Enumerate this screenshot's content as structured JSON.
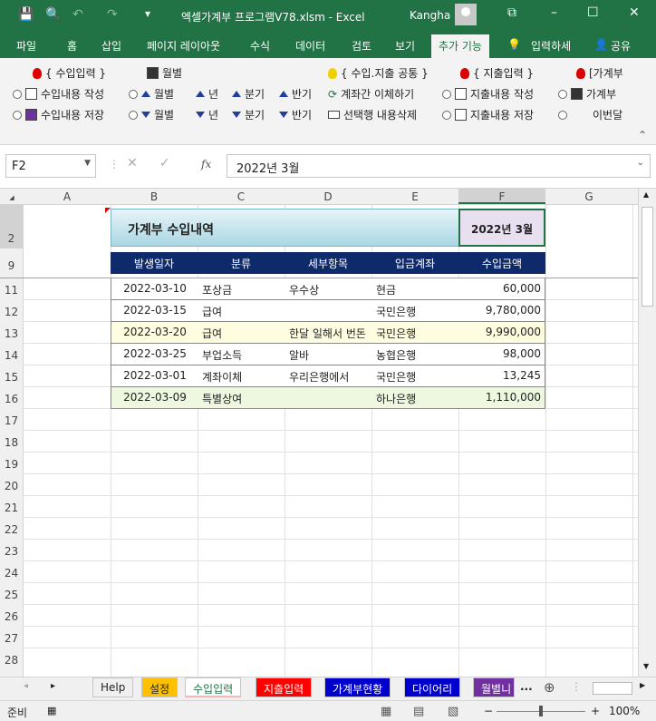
{
  "titlebar": {
    "title": "엑셀가계부 프로그램V78.xlsm  -  Excel",
    "user": "Kangha",
    "minimize_glyph": "–",
    "restore_glyph": "☐",
    "close_glyph": "✕",
    "ribbon_display_glyph": "⧉",
    "save_glyph": "💾",
    "preview_glyph": "🔍",
    "undo_glyph": "↶",
    "redo_glyph": "↷",
    "customize_glyph": "▾"
  },
  "menu": {
    "items": [
      "파일",
      "홈",
      "삽입",
      "페이지 레이아웃",
      "수식",
      "데이터",
      "검토",
      "보기",
      "추가 기능"
    ],
    "tell_me": "입력하세",
    "share": "공유"
  },
  "ribbon": {
    "income_header": "{ 수입입력 }",
    "monthly_header": "월별",
    "common_header": "{ 수입.지출 공통 }",
    "expense_header": "{ 지출입력 }",
    "ledger_header": "[가계부",
    "write_income": "수입내용 작성",
    "save_income": "수입내용 저장",
    "month_up": "월별",
    "month_down": "월별",
    "year_up": "년",
    "year_down": "년",
    "quarter_up": "분기",
    "quarter_down": "분기",
    "half_up": "반기",
    "half_down": "반기",
    "transfer": "계좌간 이체하기",
    "delete_row": "선택행 내용삭제",
    "write_expense": "지출내용 작성",
    "save_expense": "지출내용 저장",
    "ledger_item": "가계부",
    "this_month": "이번달",
    "collapse_glyph": "⌃"
  },
  "formula": {
    "name_box": "F2",
    "content": "2022년 3월",
    "cancel_glyph": "✕",
    "enter_glyph": "✓",
    "fx": "fx"
  },
  "columns": [
    "A",
    "B",
    "C",
    "D",
    "E",
    "F",
    "G"
  ],
  "rows": [
    "2",
    "9",
    "11",
    "12",
    "13",
    "14",
    "15",
    "16",
    "17",
    "18",
    "19",
    "20",
    "21",
    "22",
    "23",
    "24",
    "25",
    "26",
    "27",
    "28"
  ],
  "sheet": {
    "title": "가계부 수입내역",
    "month": "2022년 3월",
    "headers": [
      "발생일자",
      "분류",
      "세부항목",
      "입금계좌",
      "수입금액"
    ],
    "data": [
      {
        "date": "2022-03-10",
        "cat": "포상금",
        "detail": "우수상",
        "account": "현금",
        "amount": "60,000"
      },
      {
        "date": "2022-03-15",
        "cat": "급여",
        "detail": "",
        "account": "국민은행",
        "amount": "9,780,000"
      },
      {
        "date": "2022-03-20",
        "cat": "급여",
        "detail": "한달 일해서 번돈",
        "account": "국민은행",
        "amount": "9,990,000"
      },
      {
        "date": "2022-03-25",
        "cat": "부업소득",
        "detail": "알바",
        "account": "농협은행",
        "amount": "98,000"
      },
      {
        "date": "2022-03-01",
        "cat": "계좌이체",
        "detail": "우리은행에서",
        "account": "국민은행",
        "amount": "13,245"
      },
      {
        "date": "2022-03-09",
        "cat": "특별상여",
        "detail": "",
        "account": "하나은행",
        "amount": "1,110,000"
      }
    ]
  },
  "tabs": {
    "help": "Help",
    "settings": "설정",
    "income": "수입입력",
    "expense": "지출입력",
    "status": "가계부현황",
    "diary": "다이어리",
    "monthly": "월별니",
    "more": "...",
    "add_glyph": "⊕",
    "nav_glyph": "▸"
  },
  "status": {
    "ready": "준비",
    "zoom": "100%",
    "zoom_minus": "−",
    "zoom_plus": "+"
  },
  "colors": {
    "excel_green": "#217346",
    "table_header": "#0f2a6a",
    "settings_tab": "#ffc000",
    "income_tab": "#f4b6b6",
    "expense_tab": "#ff0000",
    "status_tab": "#0000cc",
    "diary_tab": "#0000cc",
    "monthly_tab": "#7030a0"
  }
}
